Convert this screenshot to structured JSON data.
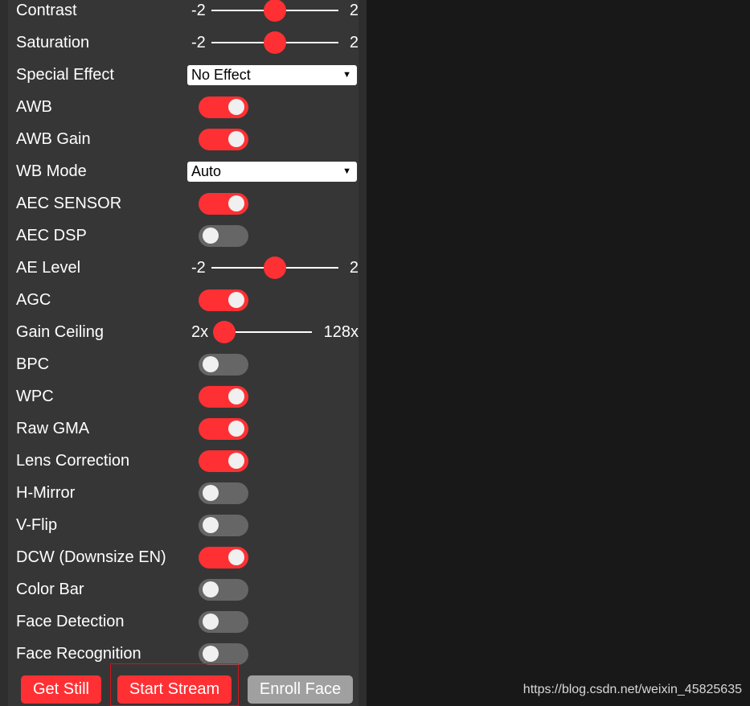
{
  "controls": {
    "contrast": {
      "label": "Contrast",
      "min": "-2",
      "max": "2",
      "value": 0
    },
    "saturation": {
      "label": "Saturation",
      "min": "-2",
      "max": "2",
      "value": 0
    },
    "special_effect": {
      "label": "Special Effect",
      "selected": "No Effect"
    },
    "awb": {
      "label": "AWB",
      "on": true
    },
    "awb_gain": {
      "label": "AWB Gain",
      "on": true
    },
    "wb_mode": {
      "label": "WB Mode",
      "selected": "Auto"
    },
    "aec_sensor": {
      "label": "AEC SENSOR",
      "on": true
    },
    "aec_dsp": {
      "label": "AEC DSP",
      "on": false
    },
    "ae_level": {
      "label": "AE Level",
      "min": "-2",
      "max": "2",
      "value": 0
    },
    "agc": {
      "label": "AGC",
      "on": true
    },
    "gain_ceiling": {
      "label": "Gain Ceiling",
      "min": "2x",
      "max": "128x",
      "value_fraction": 0.0
    },
    "bpc": {
      "label": "BPC",
      "on": false
    },
    "wpc": {
      "label": "WPC",
      "on": true
    },
    "raw_gma": {
      "label": "Raw GMA",
      "on": true
    },
    "lens_correction": {
      "label": "Lens Correction",
      "on": true
    },
    "h_mirror": {
      "label": "H-Mirror",
      "on": false
    },
    "v_flip": {
      "label": "V-Flip",
      "on": false
    },
    "dcw": {
      "label": "DCW (Downsize EN)",
      "on": true
    },
    "color_bar": {
      "label": "Color Bar",
      "on": false
    },
    "face_detection": {
      "label": "Face Detection",
      "on": false
    },
    "face_recognition": {
      "label": "Face Recognition",
      "on": false
    }
  },
  "buttons": {
    "get_still": "Get Still",
    "start_stream": "Start Stream",
    "enroll_face": "Enroll Face"
  },
  "watermark": "https://blog.csdn.net/weixin_45825635",
  "colors": {
    "accent": "#ff3034",
    "toggle_off": "#666666",
    "panel": "#363636",
    "background": "#181818",
    "disabled_button": "#a0a0a0"
  }
}
